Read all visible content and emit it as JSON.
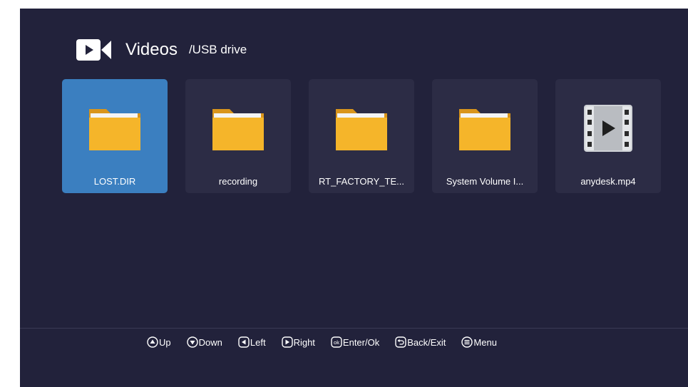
{
  "header": {
    "icon": "video-camera-icon",
    "title": "Videos",
    "path": "/USB drive"
  },
  "files": [
    {
      "name": "LOST.DIR",
      "type": "folder",
      "selected": true
    },
    {
      "name": "recording",
      "type": "folder",
      "selected": false
    },
    {
      "name": "RT_FACTORY_TE...",
      "type": "folder",
      "selected": false
    },
    {
      "name": "System Volume I...",
      "type": "folder",
      "selected": false
    },
    {
      "name": "anydesk.mp4",
      "type": "video",
      "selected": false
    }
  ],
  "hints": [
    {
      "icon": "up-arrow-icon",
      "label": "Up"
    },
    {
      "icon": "down-arrow-icon",
      "label": "Down"
    },
    {
      "icon": "left-arrow-icon",
      "label": "Left"
    },
    {
      "icon": "right-arrow-icon",
      "label": "Right"
    },
    {
      "icon": "ok-icon",
      "label": "Enter/Ok"
    },
    {
      "icon": "back-icon",
      "label": "Back/Exit"
    },
    {
      "icon": "menu-icon",
      "label": "Menu"
    }
  ],
  "colors": {
    "background": "#22223b",
    "tile": "#2c2c45",
    "selected": "#3b7fc0",
    "folder": "#f5b52a"
  }
}
